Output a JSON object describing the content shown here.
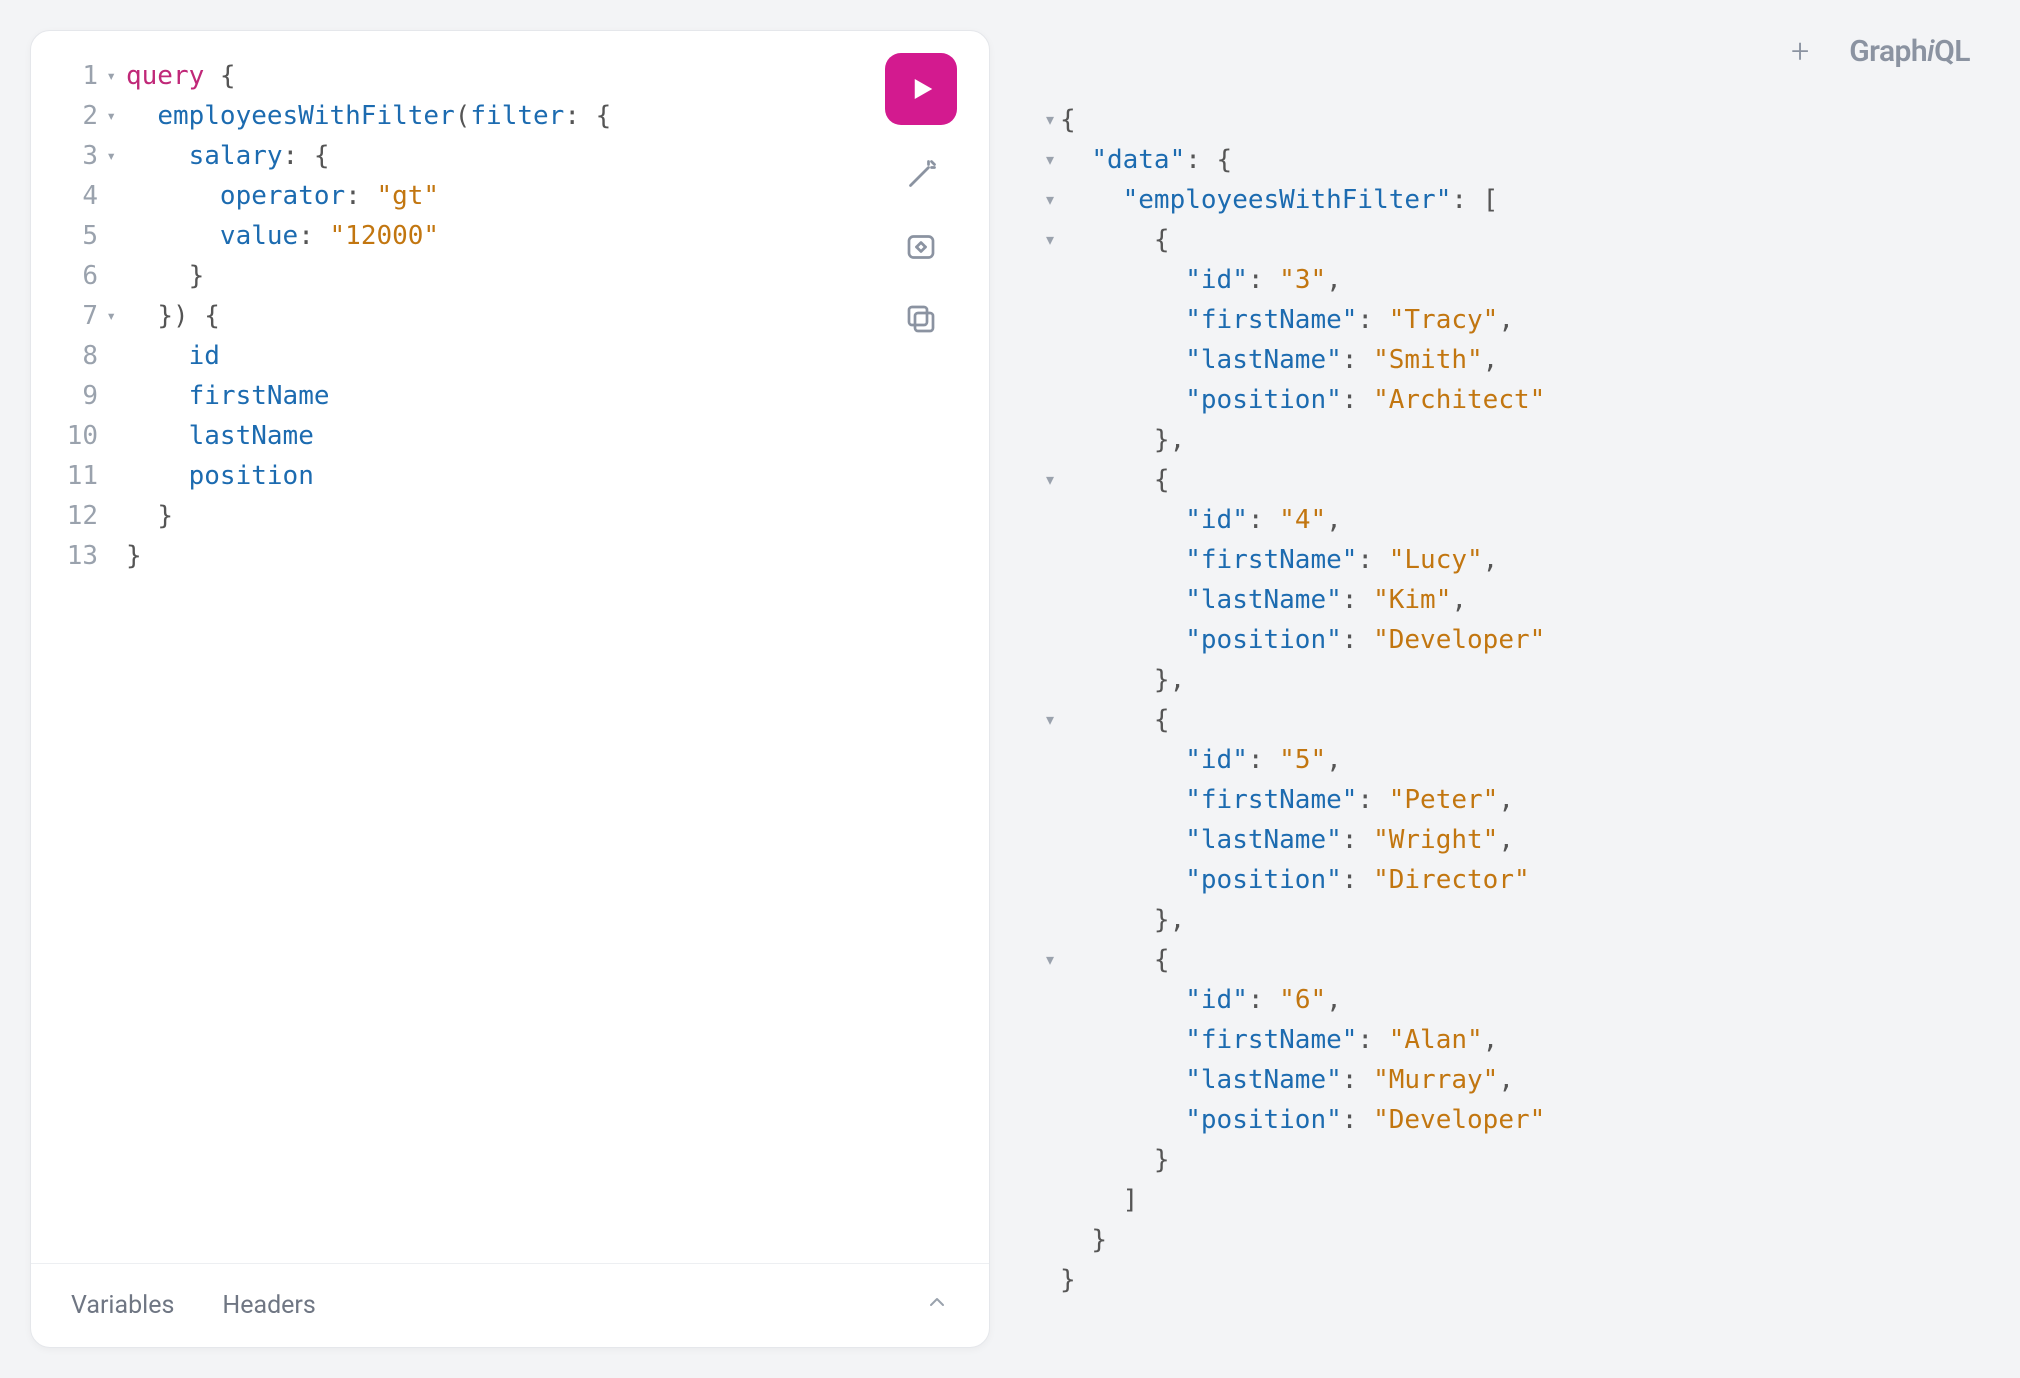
{
  "logo": {
    "part1": "Graph",
    "part2": "i",
    "part3": "QL"
  },
  "toolbar": {
    "play_label": "Execute Query"
  },
  "bottom": {
    "tab_variables": "Variables",
    "tab_headers": "Headers"
  },
  "editor": {
    "line_numbers": [
      "1",
      "2",
      "3",
      "4",
      "5",
      "6",
      "7",
      "8",
      "9",
      "10",
      "11",
      "12",
      "13"
    ],
    "fold_lines": [
      1,
      2,
      3,
      7
    ],
    "tokens": {
      "query_kw": "query",
      "employeesWithFilter": "employeesWithFilter",
      "filter": "filter",
      "salary": "salary",
      "operator_key": "operator",
      "operator_val": "\"gt\"",
      "value_key": "value",
      "value_val": "\"12000\"",
      "id": "id",
      "firstName": "firstName",
      "lastName": "lastName",
      "position": "position"
    }
  },
  "response": {
    "fold_lines": [
      1,
      2,
      3,
      4,
      9,
      14,
      19
    ],
    "json": {
      "data_key": "\"data\"",
      "ewf_key": "\"employeesWithFilter\"",
      "id_key": "\"id\"",
      "fn_key": "\"firstName\"",
      "ln_key": "\"lastName\"",
      "pos_key": "\"position\"",
      "items": [
        {
          "id": "\"3\"",
          "firstName": "\"Tracy\"",
          "lastName": "\"Smith\"",
          "position": "\"Architect\""
        },
        {
          "id": "\"4\"",
          "firstName": "\"Lucy\"",
          "lastName": "\"Kim\"",
          "position": "\"Developer\""
        },
        {
          "id": "\"5\"",
          "firstName": "\"Peter\"",
          "lastName": "\"Wright\"",
          "position": "\"Director\""
        },
        {
          "id": "\"6\"",
          "firstName": "\"Alan\"",
          "lastName": "\"Murray\"",
          "position": "\"Developer\""
        }
      ]
    }
  }
}
